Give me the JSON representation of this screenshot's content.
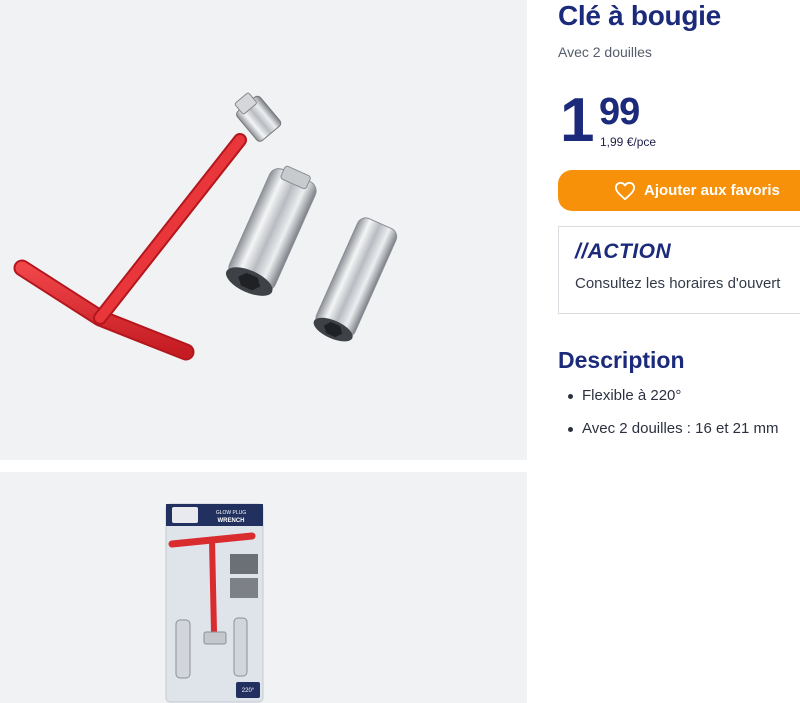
{
  "gallery": {
    "main_image_alt": "",
    "thumb_image_alt": "",
    "package": {
      "header_text": "GLOW PLUG\nWRENCH",
      "badge_text": "220°"
    }
  },
  "product": {
    "title": "Clé à bougie",
    "subtitle": "Avec 2 douilles",
    "price": {
      "integer": "1",
      "decimal": "99",
      "unit": "1,99 €/pce"
    },
    "favorite_button": {
      "label": "Ajouter aux favoris",
      "icon": "heart-icon"
    }
  },
  "store": {
    "logo_text": "//ACTION",
    "text": "Consultez les horaires d'ouvert"
  },
  "description": {
    "title": "Description",
    "items": [
      "Flexible à 220°",
      "Avec 2 douilles : 16 et 21 mm"
    ]
  },
  "colors": {
    "brand_blue": "#1b2a7a",
    "accent_orange": "#f7910a",
    "handle_red": "#e02b2b",
    "image_bg": "#f1f2f4"
  }
}
